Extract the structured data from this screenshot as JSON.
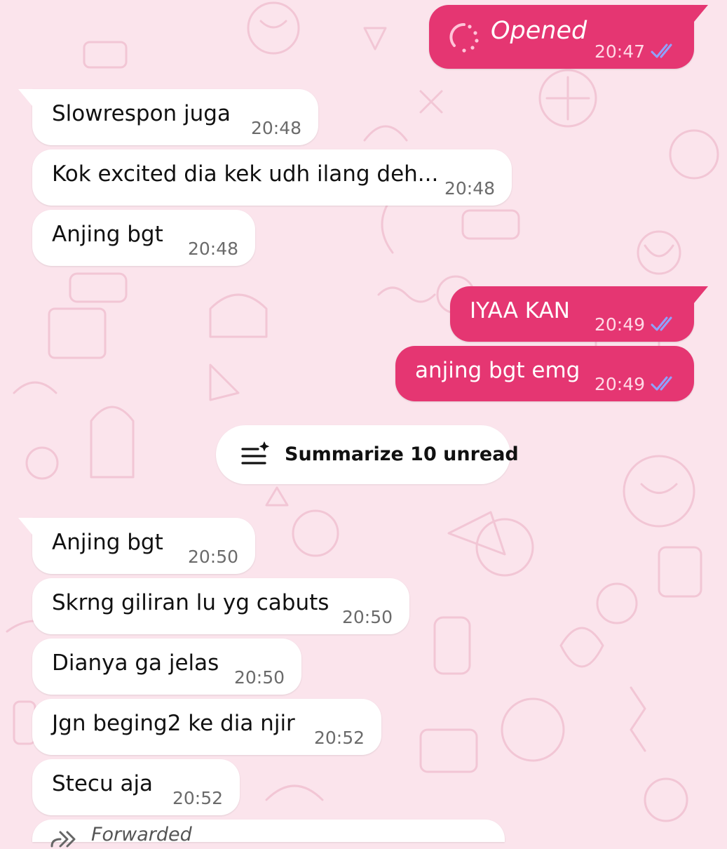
{
  "colors": {
    "background": "#fbe4ec",
    "outgoing_bubble": "#e53672",
    "incoming_bubble": "#ffffff",
    "read_ticks": "#8fa3ff"
  },
  "messages": [
    {
      "direction": "out",
      "type": "view-once",
      "text": "Opened",
      "time": "20:47",
      "status": "read",
      "icon": "view-once-spinner-icon"
    },
    {
      "direction": "in",
      "text": "Slowrespon juga",
      "time": "20:48"
    },
    {
      "direction": "in",
      "text": "Kok excited dia kek udh ilang deh...",
      "time": "20:48"
    },
    {
      "direction": "in",
      "text": "Anjing bgt",
      "time": "20:48"
    },
    {
      "direction": "out",
      "text": "IYAA KAN",
      "time": "20:49",
      "status": "read"
    },
    {
      "direction": "out",
      "text": "anjing bgt emg",
      "time": "20:49",
      "status": "read"
    },
    {
      "direction": "in",
      "text": "Anjing bgt",
      "time": "20:50"
    },
    {
      "direction": "in",
      "text": "Skrng giliran lu yg cabuts",
      "time": "20:50"
    },
    {
      "direction": "in",
      "text": "Dianya ga jelas",
      "time": "20:50"
    },
    {
      "direction": "in",
      "text": "Jgn beging2 ke dia njir",
      "time": "20:52"
    },
    {
      "direction": "in",
      "text": "Stecu aja",
      "time": "20:52"
    },
    {
      "direction": "in",
      "type": "forwarded",
      "label": "Forwarded",
      "icon": "forward-arrow-icon"
    }
  ],
  "summarize": {
    "label": "Summarize 10 unread",
    "icon": "ai-summarize-icon"
  }
}
